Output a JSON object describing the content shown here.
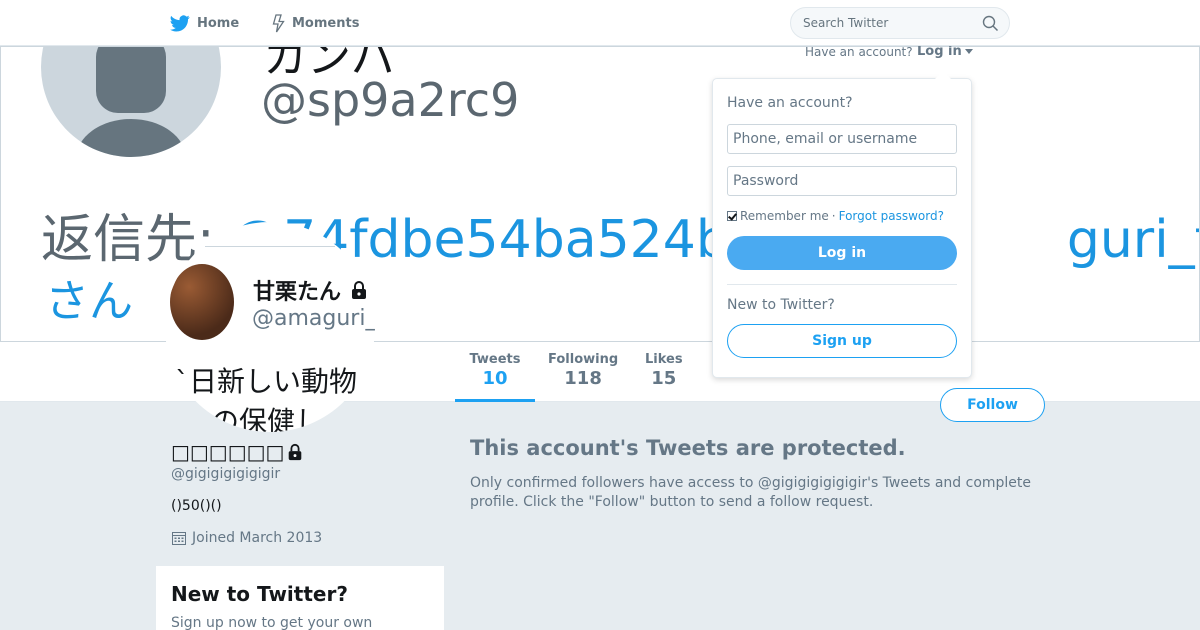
{
  "colors": {
    "accent": "#1da1f2",
    "text_secondary": "#657786",
    "background": "#e6ecf0"
  },
  "nav": {
    "home_label": "Home",
    "home_icon": "twitter-bird-icon",
    "moments_label": "Moments",
    "moments_icon": "lightning-icon",
    "search_placeholder": "Search Twitter",
    "search_icon": "search-icon"
  },
  "banner": {
    "top_name_partial": "カンパ",
    "handle": "@sp9a2rc9",
    "reply_prefix": "返信先: ",
    "reply_link": "@74fdbe54ba524beさ",
    "reply_link_end": "guri_tan",
    "reply_line2": "さん"
  },
  "avatar_card": {
    "name": "甘栗たん",
    "handle": "@amaguri_ta",
    "bio_line1": "`日新しい動物",
    "bio_line2": "の保健し"
  },
  "stats": [
    {
      "label": "Tweets",
      "value": "10"
    },
    {
      "label": "Following",
      "value": "118"
    },
    {
      "label": "Likes",
      "value": "15"
    }
  ],
  "follow_label": "Follow",
  "profile": {
    "name": "□□□□□□",
    "handle": "@gigigigigigigir",
    "bio": "()50()()",
    "joined": "Joined March 2013",
    "lock_icon": "lock-icon",
    "calendar_icon": "calendar-icon"
  },
  "signup_module": {
    "title": "New to Twitter?",
    "subtitle": "Sign up now to get your own"
  },
  "protected": {
    "title": "This account's Tweets are protected.",
    "text": "Only confirmed followers have access to @gigigigigigigir's Tweets and complete profile. Click the \"Follow\" button to send a follow request."
  },
  "login": {
    "have_account": "Have an account?",
    "toggle_label": "Log in",
    "dropdown_heading": "Have an account?",
    "username_placeholder": "Phone, email or username",
    "password_placeholder": "Password",
    "remember_me": "Remember me",
    "separator": "·",
    "forgot_password": "Forgot password?",
    "login_button": "Log in",
    "new_to_twitter": "New to Twitter?",
    "signup_button": "Sign up"
  }
}
